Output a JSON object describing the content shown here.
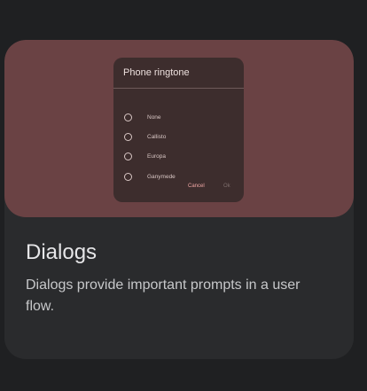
{
  "card": {
    "title": "Dialogs",
    "description": "Dialogs provide important prompts in a user flow."
  },
  "preview_dialog": {
    "title": "Phone ringtone",
    "options": [
      "None",
      "Callisto",
      "Europa",
      "Ganymede"
    ],
    "cancel_label": "Cancel",
    "ok_label": "Ok"
  },
  "colors": {
    "page_background": "#1f2022",
    "card_background": "#2a2b2d",
    "hero_background": "#6a4244",
    "dialog_background": "#3d2d2d",
    "cancel_accent": "#f0a7a5"
  }
}
